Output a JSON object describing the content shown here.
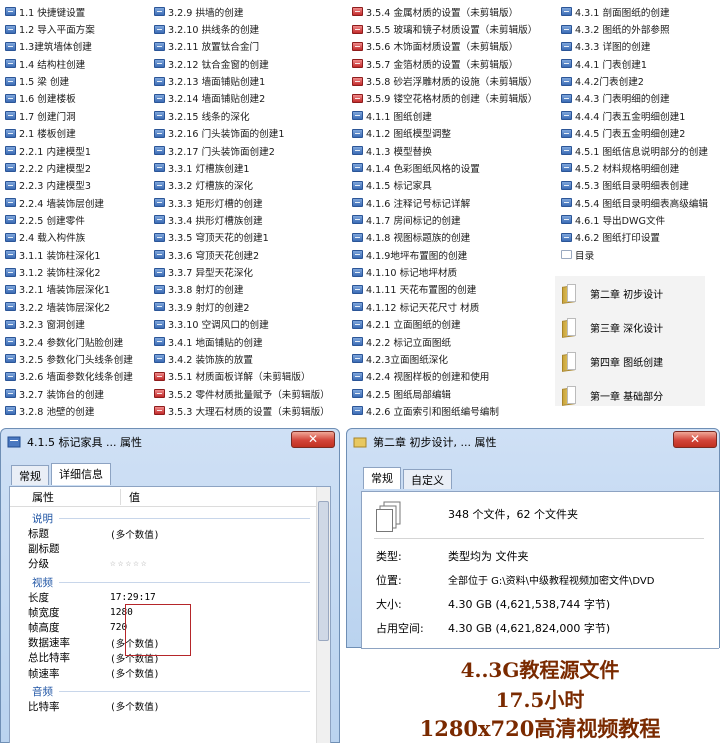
{
  "file_list": {
    "col1": [
      {
        "icon": "blue",
        "label": "1.1 快捷键设置"
      },
      {
        "icon": "blue",
        "label": "1.2 导入平面方案"
      },
      {
        "icon": "blue",
        "label": "1.3建筑墙体创建"
      },
      {
        "icon": "blue",
        "label": "1.4 结构柱创建"
      },
      {
        "icon": "blue",
        "label": "1.5 梁 创建"
      },
      {
        "icon": "blue",
        "label": "1.6 创建楼板"
      },
      {
        "icon": "blue",
        "label": "1.7 创建门洞"
      },
      {
        "icon": "blue",
        "label": "2.1 楼板创建"
      },
      {
        "icon": "blue",
        "label": "2.2.1 内建模型1"
      },
      {
        "icon": "blue",
        "label": "2.2.2 内建模型2"
      },
      {
        "icon": "blue",
        "label": "2.2.3 内建模型3"
      },
      {
        "icon": "blue",
        "label": "2.2.4 墙装饰层创建"
      },
      {
        "icon": "blue",
        "label": "2.2.5 创建零件"
      },
      {
        "icon": "blue",
        "label": "2.4 载入构件族"
      },
      {
        "icon": "blue",
        "label": "3.1.1 装饰柱深化1"
      },
      {
        "icon": "blue",
        "label": "3.1.2 装饰柱深化2"
      },
      {
        "icon": "blue",
        "label": "3.2.1 墙装饰层深化1"
      },
      {
        "icon": "blue",
        "label": "3.2.2 墙装饰层深化2"
      },
      {
        "icon": "blue",
        "label": "3.2.3 窗洞创建"
      },
      {
        "icon": "blue",
        "label": "3.2.4 参数化门贴脸创建"
      },
      {
        "icon": "blue",
        "label": "3.2.5 参数化门头线条创建"
      },
      {
        "icon": "blue",
        "label": "3.2.6 墙面参数化线条创建"
      },
      {
        "icon": "blue",
        "label": "3.2.7 装饰台的创建"
      },
      {
        "icon": "blue",
        "label": "3.2.8 池壁的创建"
      }
    ],
    "col2": [
      {
        "icon": "blue",
        "label": "3.2.9 拱墙的创建"
      },
      {
        "icon": "blue",
        "label": "3.2.10 拱线条的创建"
      },
      {
        "icon": "blue",
        "label": "3.2.11 放置钛合金门"
      },
      {
        "icon": "blue",
        "label": "3.2.12 钛合金窗的创建"
      },
      {
        "icon": "blue",
        "label": "3.2.13 墙面铺贴创建1"
      },
      {
        "icon": "blue",
        "label": "3.2.14 墙面铺贴创建2"
      },
      {
        "icon": "blue",
        "label": "3.2.15 线条的深化"
      },
      {
        "icon": "blue",
        "label": "3.2.16 门头装饰面的创建1"
      },
      {
        "icon": "blue",
        "label": "3.2.17 门头装饰面创建2"
      },
      {
        "icon": "blue",
        "label": "3.3.1 灯槽族创建1"
      },
      {
        "icon": "blue",
        "label": "3.3.2 灯槽族的深化"
      },
      {
        "icon": "blue",
        "label": "3.3.3 矩形灯槽的创建"
      },
      {
        "icon": "blue",
        "label": "3.3.4 拱形灯槽族创建"
      },
      {
        "icon": "blue",
        "label": "3.3.5 穹顶天花的创建1"
      },
      {
        "icon": "blue",
        "label": "3.3.6 穹顶天花创建2"
      },
      {
        "icon": "blue",
        "label": "3.3.7 异型天花深化"
      },
      {
        "icon": "blue",
        "label": "3.3.8 射灯的创建"
      },
      {
        "icon": "blue",
        "label": "3.3.9 射灯的创建2"
      },
      {
        "icon": "blue",
        "label": "3.3.10 空调风口的创建"
      },
      {
        "icon": "blue",
        "label": "3.4.1 地面铺贴的创建"
      },
      {
        "icon": "blue",
        "label": "3.4.2 装饰族的放置"
      },
      {
        "icon": "red",
        "label": "3.5.1 材质面板详解（未剪辑版）"
      },
      {
        "icon": "red",
        "label": "3.5.2 零件材质批量赋予（未剪辑版）"
      },
      {
        "icon": "red",
        "label": "3.5.3 大理石材质的设置（未剪辑版）"
      }
    ],
    "col3": [
      {
        "icon": "red",
        "label": "3.5.4 金属材质的设置（未剪辑版）"
      },
      {
        "icon": "red",
        "label": "3.5.5 玻璃和镜子材质设置（未剪辑版）"
      },
      {
        "icon": "red",
        "label": "3.5.6 木饰面材质设置（未剪辑版）"
      },
      {
        "icon": "red",
        "label": "3.5.7 金箔材质的设置（未剪辑版）"
      },
      {
        "icon": "red",
        "label": "3.5.8 砂岩浮雕材质的设施（未剪辑版）"
      },
      {
        "icon": "red",
        "label": "3.5.9 镂空花格材质的创建（未剪辑版）"
      },
      {
        "icon": "blue",
        "label": "4.1.1 图纸创建"
      },
      {
        "icon": "blue",
        "label": "4.1.2 图纸模型调整"
      },
      {
        "icon": "blue",
        "label": "4.1.3 模型替换"
      },
      {
        "icon": "blue",
        "label": "4.1.4 色彩图纸风格的设置"
      },
      {
        "icon": "blue",
        "label": "4.1.5 标记家具"
      },
      {
        "icon": "blue",
        "label": "4.1.6 注释记号标记详解"
      },
      {
        "icon": "blue",
        "label": "4.1.7 房间标记的创建"
      },
      {
        "icon": "blue",
        "label": "4.1.8 视图标题族的创建"
      },
      {
        "icon": "blue",
        "label": "4.1.9地坪布置图的创建"
      },
      {
        "icon": "blue",
        "label": "4.1.10 标记地坪材质"
      },
      {
        "icon": "blue",
        "label": "4.1.11 天花布置图的创建"
      },
      {
        "icon": "blue",
        "label": "4.1.12 标记天花尺寸 材质"
      },
      {
        "icon": "blue",
        "label": "4.2.1 立面图纸的创建"
      },
      {
        "icon": "blue",
        "label": "4.2.2 标记立面图纸"
      },
      {
        "icon": "blue",
        "label": "4.2.3立面图纸深化"
      },
      {
        "icon": "blue",
        "label": "4.2.4 视图样板的创建和使用"
      },
      {
        "icon": "blue",
        "label": "4.2.5 图纸局部编辑"
      },
      {
        "icon": "blue",
        "label": "4.2.6 立面索引和图纸编号编制"
      }
    ],
    "col4": [
      {
        "icon": "blue",
        "label": "4.3.1 剖面图纸的创建"
      },
      {
        "icon": "blue",
        "label": "4.3.2 图纸的外部参照"
      },
      {
        "icon": "blue",
        "label": "4.3.3 详图的创建"
      },
      {
        "icon": "blue",
        "label": "4.4.1 门表创建1"
      },
      {
        "icon": "blue",
        "label": "4.4.2门表创建2"
      },
      {
        "icon": "blue",
        "label": "4.4.3 门表明细的创建"
      },
      {
        "icon": "blue",
        "label": "4.4.4 门表五金明细创建1"
      },
      {
        "icon": "blue",
        "label": "4.4.5 门表五金明细创建2"
      },
      {
        "icon": "blue",
        "label": "4.5.1 图纸信息说明部分的创建"
      },
      {
        "icon": "blue",
        "label": "4.5.2 材料规格明细创建"
      },
      {
        "icon": "blue",
        "label": "4.5.3 图纸目录明细表创建"
      },
      {
        "icon": "blue",
        "label": "4.5.4 图纸目录明细表高级编辑"
      },
      {
        "icon": "blue",
        "label": "4.6.1 导出DWG文件"
      },
      {
        "icon": "blue",
        "label": "4.6.2 图纸打印设置"
      },
      {
        "icon": "file",
        "label": "目录"
      }
    ]
  },
  "folders": [
    {
      "label": "第二章 初步设计"
    },
    {
      "label": "第三章 深化设计"
    },
    {
      "label": "第四章 图纸创建"
    },
    {
      "label": "第一章 基础部分"
    }
  ],
  "dialog1": {
    "title": "4.1.5 标记家具 ... 属性",
    "tabs": [
      "常规",
      "详细信息"
    ],
    "col_property": "属性",
    "col_value": "值",
    "sections": [
      {
        "name": "说明",
        "rows": [
          {
            "k": "标题",
            "v": "(多个数值)"
          },
          {
            "k": "副标题",
            "v": ""
          },
          {
            "k": "分级",
            "v": "☆☆☆☆☆"
          }
        ]
      },
      {
        "name": "视频",
        "rows": [
          {
            "k": "长度",
            "v": "17:29:17"
          },
          {
            "k": "帧宽度",
            "v": "1280"
          },
          {
            "k": "帧高度",
            "v": "720"
          },
          {
            "k": "数据速率",
            "v": "(多个数值)"
          },
          {
            "k": "总比特率",
            "v": "(多个数值)"
          },
          {
            "k": "帧速率",
            "v": "(多个数值)"
          }
        ]
      },
      {
        "name": "音频",
        "rows": [
          {
            "k": "比特率",
            "v": "(多个数值)"
          }
        ]
      }
    ],
    "close": "✕"
  },
  "dialog2": {
    "title": "第二章 初步设计, ... 属性",
    "tabs": [
      "常规",
      "自定义"
    ],
    "summary": "348 个文件，62 个文件夹",
    "type_k": "类型:",
    "type_v": "类型均为 文件夹",
    "loc_k": "位置:",
    "loc_v": "全部位于 G:\\资料\\中级教程视频加密文件\\DVD",
    "size_k": "大小:",
    "size_v": "4.30 GB (4,621,538,744 字节)",
    "used_k": "占用空间:",
    "used_v": "4.30 GB (4,621,824,000 字节)",
    "close": "✕"
  },
  "promo": {
    "line1": "4..3G教程源文件",
    "line2": "17.5小时",
    "line3": "1280x720高清视频教程"
  }
}
